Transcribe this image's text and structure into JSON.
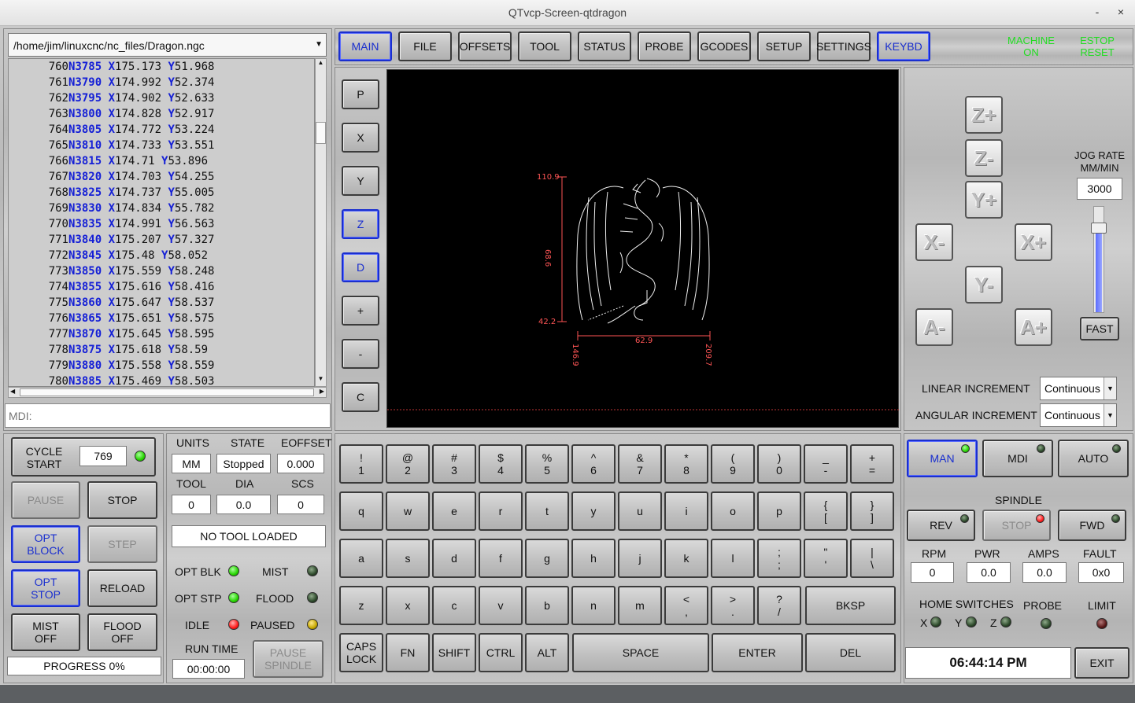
{
  "window": {
    "title": "QTvcp-Screen-qtdragon",
    "minimize": "-",
    "close": "×"
  },
  "file": {
    "path": "/home/jim/linuxcnc/nc_files/Dragon.ngc"
  },
  "gcode_lines": [
    {
      "num": "760",
      "n": "N3785",
      "x": "175.173",
      "y": "51.968"
    },
    {
      "num": "761",
      "n": "N3790",
      "x": "174.992",
      "y": "52.374"
    },
    {
      "num": "762",
      "n": "N3795",
      "x": "174.902",
      "y": "52.633"
    },
    {
      "num": "763",
      "n": "N3800",
      "x": "174.828",
      "y": "52.917"
    },
    {
      "num": "764",
      "n": "N3805",
      "x": "174.772",
      "y": "53.224"
    },
    {
      "num": "765",
      "n": "N3810",
      "x": "174.733",
      "y": "53.551"
    },
    {
      "num": "766",
      "n": "N3815",
      "x": "174.71",
      "y": "53.896"
    },
    {
      "num": "767",
      "n": "N3820",
      "x": "174.703",
      "y": "54.255"
    },
    {
      "num": "768",
      "n": "N3825",
      "x": "174.737",
      "y": "55.005"
    },
    {
      "num": "769",
      "n": "N3830",
      "x": "174.834",
      "y": "55.782"
    },
    {
      "num": "770",
      "n": "N3835",
      "x": "174.991",
      "y": "56.563"
    },
    {
      "num": "771",
      "n": "N3840",
      "x": "175.207",
      "y": "57.327"
    },
    {
      "num": "772",
      "n": "N3845",
      "x": "175.48",
      "y": "58.052"
    },
    {
      "num": "773",
      "n": "N3850",
      "x": "175.559",
      "y": "58.248"
    },
    {
      "num": "774",
      "n": "N3855",
      "x": "175.616",
      "y": "58.416"
    },
    {
      "num": "775",
      "n": "N3860",
      "x": "175.647",
      "y": "58.537"
    },
    {
      "num": "776",
      "n": "N3865",
      "x": "175.651",
      "y": "58.575"
    },
    {
      "num": "777",
      "n": "N3870",
      "x": "175.645",
      "y": "58.595"
    },
    {
      "num": "778",
      "n": "N3875",
      "x": "175.618",
      "y": "58.59"
    },
    {
      "num": "779",
      "n": "N3880",
      "x": "175.558",
      "y": "58.559"
    },
    {
      "num": "780",
      "n": "N3885",
      "x": "175.469",
      "y": "58.503"
    }
  ],
  "mdi": {
    "placeholder": "MDI:"
  },
  "tabs": [
    "MAIN",
    "FILE",
    "OFFSETS",
    "TOOL",
    "STATUS",
    "PROBE",
    "GCODES",
    "SETUP",
    "SETTINGS",
    "KEYBD"
  ],
  "machine": {
    "machine_on": "MACHINE ON",
    "estop_reset": "ESTOP RESET",
    "status_color": "#22dd22"
  },
  "view_buttons": [
    "P",
    "X",
    "Y",
    "Z",
    "D",
    "+",
    "-",
    "C"
  ],
  "preview": {
    "dims": {
      "y_max": "110.9",
      "y_len": "68.6",
      "y_min": "42.2",
      "x_min": "146.9",
      "x_len": "62.9",
      "x_max": "209.7"
    },
    "dim_color": "#ff5555"
  },
  "jog": {
    "buttons": {
      "zplus": "Z+",
      "zminus": "Z-",
      "yplus": "Y+",
      "xminus": "X-",
      "xplus": "X+",
      "yminus": "Y-",
      "aminus": "A-",
      "aplus": "A+"
    },
    "rate_label": "JOG RATE MM/MIN",
    "rate_value": "3000",
    "fast": "FAST",
    "rate_slider": 0.8,
    "linear_label": "LINEAR INCREMENT",
    "linear_value": "Continuous",
    "angular_label": "ANGULAR INCREMENT",
    "angular_value": "Continuous"
  },
  "control": {
    "cycle_start": "CYCLE START",
    "line_value": "769",
    "pause": "PAUSE",
    "stop": "STOP",
    "opt_block": "OPT BLOCK",
    "step": "STEP",
    "opt_stop": "OPT STOP",
    "reload": "RELOAD",
    "mist_off": "MIST OFF",
    "flood_off": "FLOOD OFF",
    "progress": "PROGRESS 0%"
  },
  "status": {
    "units_label": "UNITS",
    "units": "MM",
    "state_label": "STATE",
    "state": "Stopped",
    "eoffset_label": "EOFFSET",
    "eoffset": "0.000",
    "tool_label": "TOOL",
    "tool": "0",
    "dia_label": "DIA",
    "dia": "0.0",
    "scs_label": "SCS",
    "scs": "0",
    "tool_loaded": "NO TOOL LOADED",
    "opt_blk": "OPT BLK",
    "mist": "MIST",
    "opt_stp": "OPT STP",
    "flood": "FLOOD",
    "idle": "IDLE",
    "paused": "PAUSED",
    "run_time_label": "RUN TIME",
    "run_time": "00:00:00",
    "pause_spindle": "PAUSE SPINDLE"
  },
  "keyboard": {
    "row1": [
      [
        "!",
        "1"
      ],
      [
        "@",
        "2"
      ],
      [
        "#",
        "3"
      ],
      [
        "$",
        "4"
      ],
      [
        "%",
        "5"
      ],
      [
        "^",
        "6"
      ],
      [
        "&",
        "7"
      ],
      [
        "*",
        "8"
      ],
      [
        "(",
        "9"
      ],
      [
        ")",
        "0"
      ],
      [
        "_",
        "-"
      ],
      [
        "+",
        "="
      ]
    ],
    "row2": [
      [
        "q"
      ],
      [
        "w"
      ],
      [
        "e"
      ],
      [
        "r"
      ],
      [
        "t"
      ],
      [
        "y"
      ],
      [
        "u"
      ],
      [
        "i"
      ],
      [
        "o"
      ],
      [
        "p"
      ],
      [
        "{",
        "["
      ],
      [
        "}",
        "]"
      ]
    ],
    "row3": [
      [
        "a"
      ],
      [
        "s"
      ],
      [
        "d"
      ],
      [
        "f"
      ],
      [
        "g"
      ],
      [
        "h"
      ],
      [
        "j"
      ],
      [
        "k"
      ],
      [
        "l"
      ],
      [
        ";",
        ";"
      ],
      [
        "\"",
        "'"
      ],
      [
        "|",
        "\\"
      ]
    ],
    "row4": [
      [
        "z"
      ],
      [
        "x"
      ],
      [
        "c"
      ],
      [
        "v"
      ],
      [
        "b"
      ],
      [
        "n"
      ],
      [
        "m"
      ],
      [
        "<",
        ","
      ],
      [
        ">",
        "."
      ],
      [
        "?",
        "/"
      ]
    ],
    "bksp": "BKSP",
    "caps": "CAPS LOCK",
    "fn": "FN",
    "shift": "SHIFT",
    "ctrl": "CTRL",
    "alt": "ALT",
    "space": "SPACE",
    "enter": "ENTER",
    "del": "DEL"
  },
  "modes": {
    "man": "MAN",
    "mdi": "MDI",
    "auto": "AUTO"
  },
  "spindle": {
    "label": "SPINDLE",
    "rev": "REV",
    "stop": "STOP",
    "fwd": "FWD",
    "rpm_label": "RPM",
    "rpm": "0",
    "pwr_label": "PWR",
    "pwr": "0.0",
    "amps_label": "AMPS",
    "amps": "0.0",
    "fault_label": "FAULT",
    "fault": "0x0"
  },
  "switches": {
    "home_label": "HOME SWITCHES",
    "x": "X",
    "y": "Y",
    "z": "Z",
    "probe": "PROBE",
    "limit": "LIMIT"
  },
  "clock": "06:44:14 PM",
  "exit": "EXIT"
}
